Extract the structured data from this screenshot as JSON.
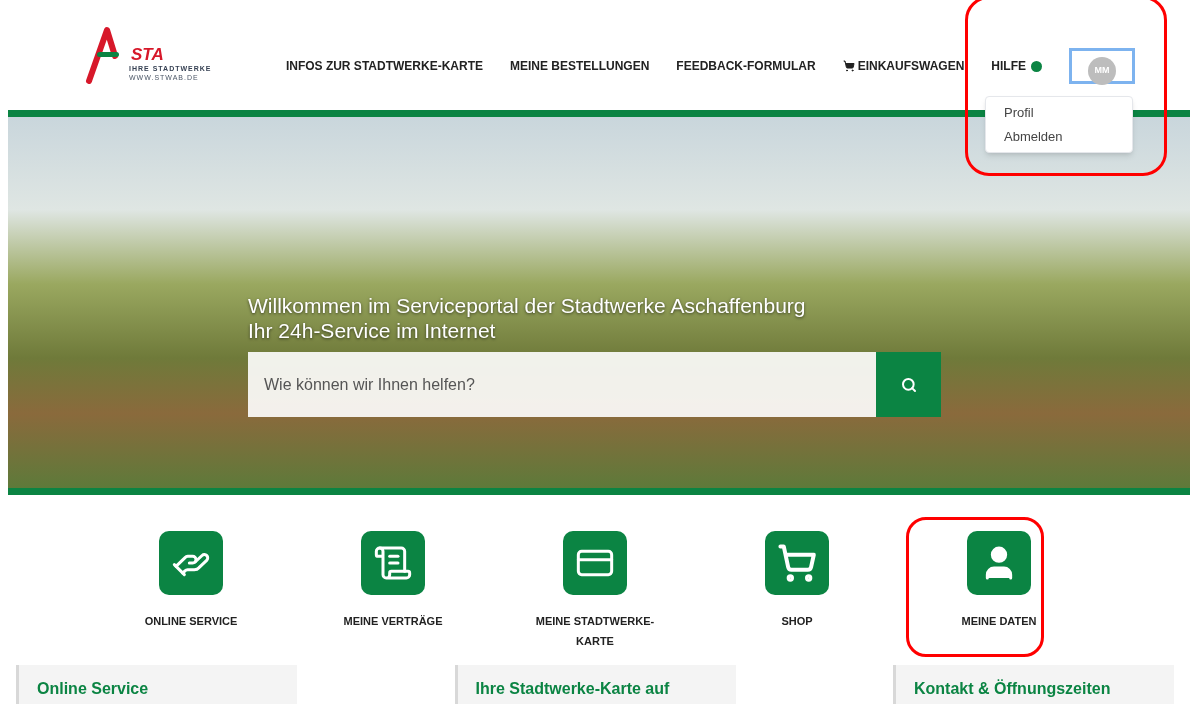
{
  "logo": {
    "mark": "STA",
    "tagline": "IHRE STADTWERKE",
    "url": "WWW.STWAB.DE"
  },
  "nav": [
    {
      "label": "INFOS ZUR STADTWERKE-KARTE",
      "kind": "plain"
    },
    {
      "label": "MEINE BESTELLUNGEN",
      "kind": "plain"
    },
    {
      "label": "FEEDBACK-FORMULAR",
      "kind": "plain"
    },
    {
      "label": "EINKAUFSWAGEN",
      "kind": "cart"
    },
    {
      "label": "HILFE",
      "kind": "status"
    }
  ],
  "user_menu": {
    "initials": "MM",
    "focused": true,
    "expanded": true,
    "highlighted": true,
    "items": [
      "Profil",
      "Abmelden"
    ]
  },
  "hero": {
    "title": "Willkommen im Serviceportal der Stadtwerke Aschaffenburg",
    "subtitle": "Ihr 24h-Service im Internet",
    "search": {
      "placeholder": "Wie können wir Ihnen helfen?"
    }
  },
  "tiles": [
    {
      "label": "ONLINE SERVICE",
      "kind": "service",
      "highlighted": false
    },
    {
      "label": "MEINE VERTRÄGE",
      "kind": "contracts",
      "highlighted": false
    },
    {
      "label": "MEINE STADTWERKE-KARTE",
      "kind": "card",
      "highlighted": false
    },
    {
      "label": "SHOP",
      "kind": "shop",
      "highlighted": false
    },
    {
      "label": "MEINE DATEN",
      "kind": "profile",
      "highlighted": true
    }
  ],
  "cards": [
    {
      "title": "Online Service"
    },
    {
      "title": "Ihre Stadtwerke-Karte auf"
    },
    {
      "title": "Kontakt & Öffnungszeiten"
    }
  ]
}
